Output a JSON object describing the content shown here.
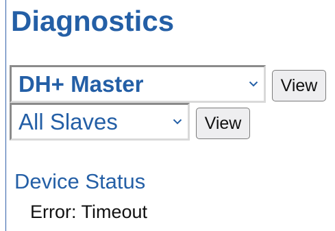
{
  "page": {
    "title": "Diagnostics"
  },
  "controls": {
    "master_select": {
      "selected": "DH+ Master",
      "icon": "chevron-down-icon"
    },
    "master_view_label": "View",
    "slaves_select": {
      "selected": "All Slaves",
      "icon": "chevron-down-icon"
    },
    "slaves_view_label": "View"
  },
  "status": {
    "heading": "Device Status",
    "message": "Error: Timeout"
  },
  "colors": {
    "accent": "#245fa6",
    "text": "#111111",
    "button_bg": "#eeeef0"
  }
}
